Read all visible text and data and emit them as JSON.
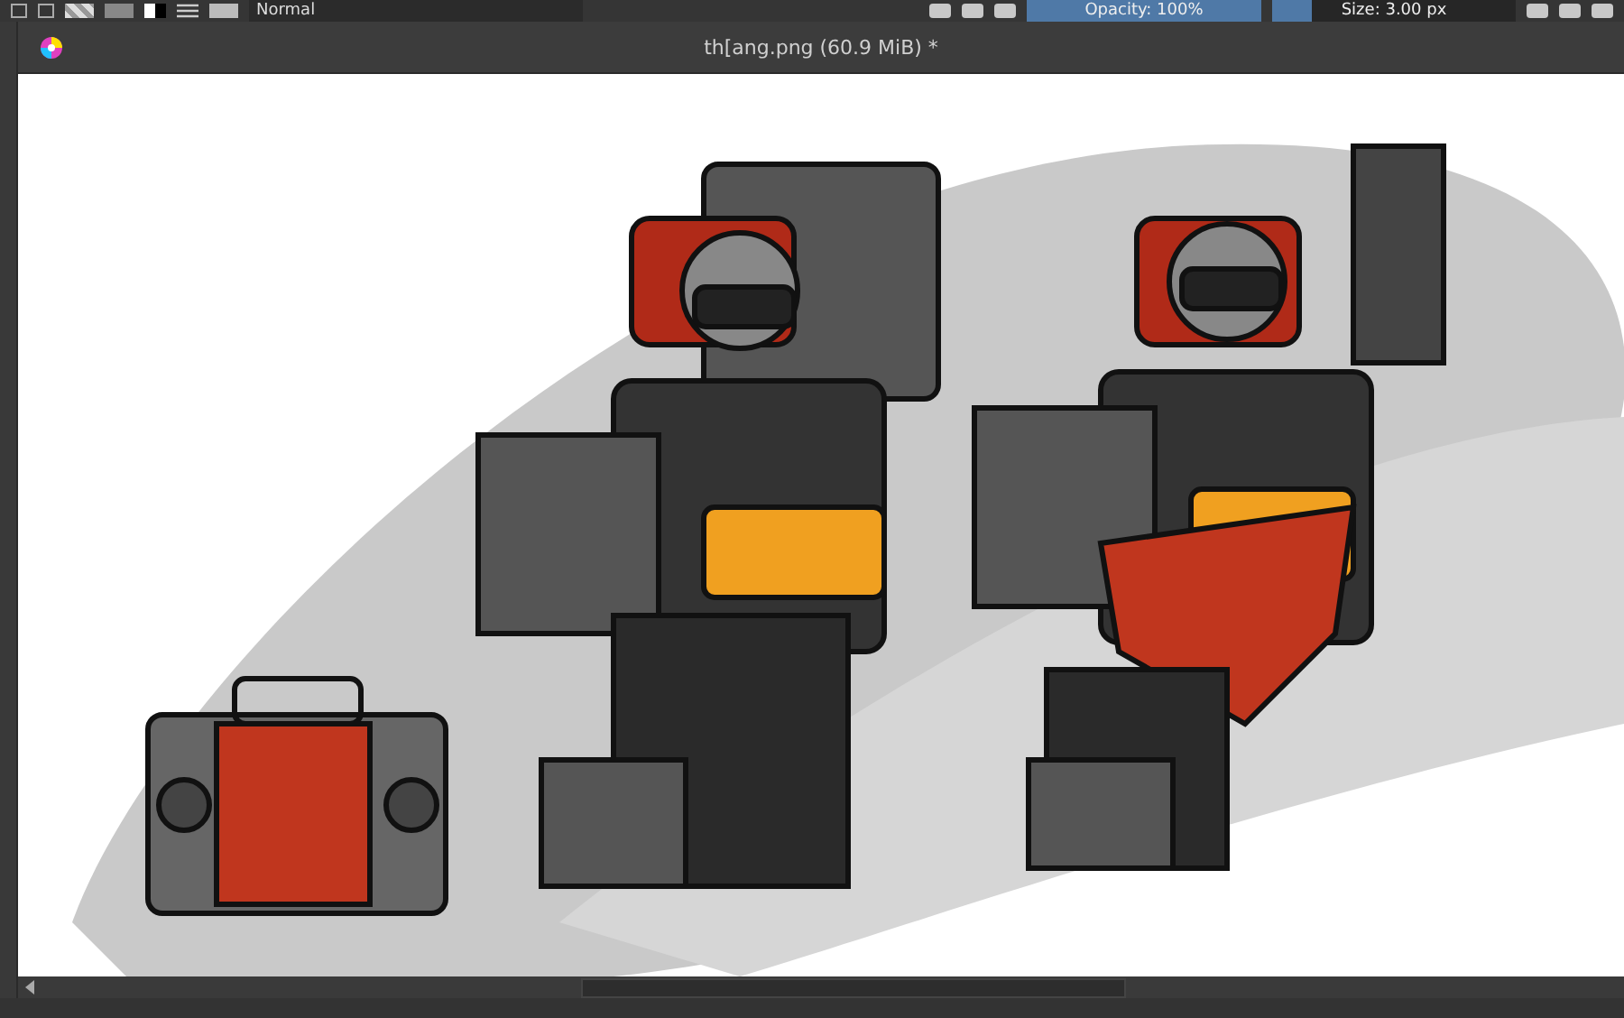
{
  "toolbar": {
    "blend_mode": "Normal",
    "opacity": {
      "label": "Opacity: 100%",
      "level": 1
    },
    "size": {
      "label": "Size: 3.00 px",
      "level": 0.16
    }
  },
  "document_tab": {
    "title": "th[ang.png (60.9 MiB) *"
  }
}
